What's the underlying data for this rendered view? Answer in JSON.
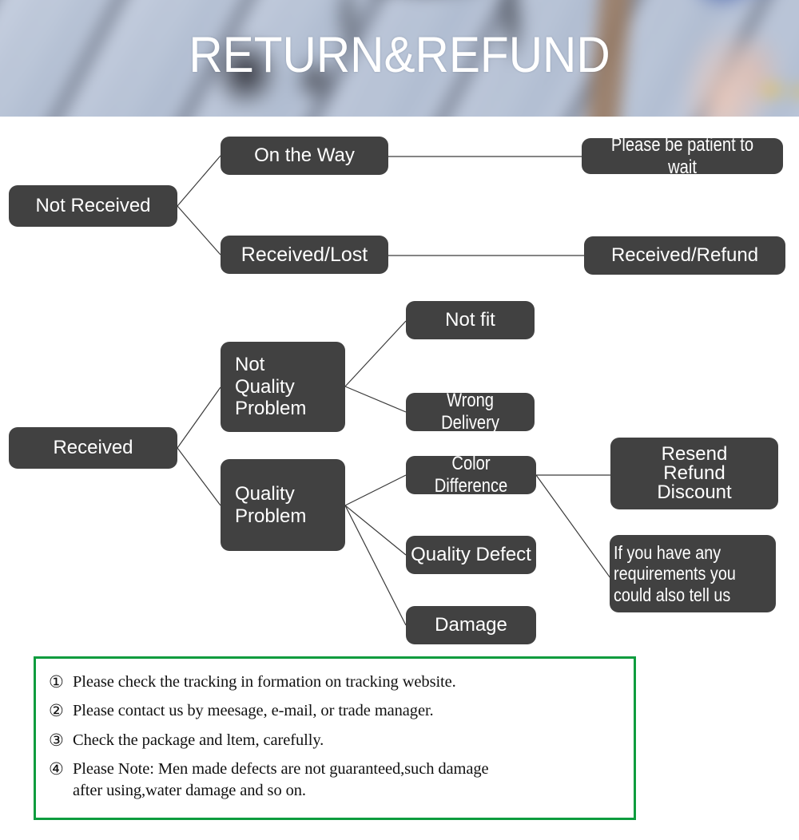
{
  "header": {
    "title": "RETURN&REFUND"
  },
  "flow": {
    "nodes": [
      {
        "id": "not-received",
        "label": "Not Received"
      },
      {
        "id": "on-the-way",
        "label": "On the Way"
      },
      {
        "id": "received-lost",
        "label": "Received/Lost"
      },
      {
        "id": "please-be-patient",
        "label": "Please be patient to wait"
      },
      {
        "id": "received-refund",
        "label": "Received/Refund"
      },
      {
        "id": "received",
        "label": "Received"
      },
      {
        "id": "not-quality-problem",
        "label": "Not\nQuality\nProblem"
      },
      {
        "id": "quality-problem",
        "label": "Quality\nProblem"
      },
      {
        "id": "not-fit",
        "label": "Not fit"
      },
      {
        "id": "wrong-delivery",
        "label": "Wrong Delivery"
      },
      {
        "id": "color-difference",
        "label": "Color Difference"
      },
      {
        "id": "quality-defect",
        "label": "Quality Defect"
      },
      {
        "id": "damage",
        "label": "Damage"
      },
      {
        "id": "resend-refund-discount",
        "label": "Resend\nRefund\nDiscount"
      },
      {
        "id": "requirements",
        "label": "If you have any\nrequirements you\ncould also tell us"
      }
    ],
    "box_color": "#414141",
    "text_color": "#ffffff",
    "line_color": "#3a3a3a"
  },
  "notes": {
    "border_color": "#0d9c3e",
    "items": [
      {
        "num": "①",
        "text": "Please check the tracking in formation on tracking website."
      },
      {
        "num": "②",
        "text": "Please contact us by meesage, e-mail, or trade manager."
      },
      {
        "num": "③",
        "text": "Check the package and ltem, carefully."
      },
      {
        "num": "④",
        "text": "Please Note: Men made defects  are not guaranteed,such damage\nafter using,water damage and so on."
      }
    ]
  }
}
